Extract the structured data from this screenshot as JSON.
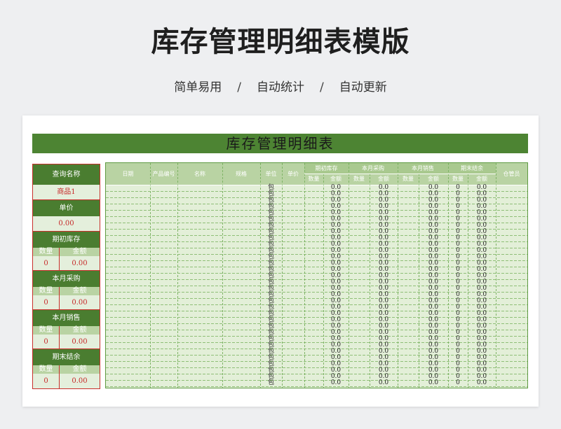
{
  "hero": {
    "title": "库存管理明细表模版",
    "tags": [
      "简单易用",
      "自动统计",
      "自动更新"
    ],
    "separator": "/"
  },
  "sheet": {
    "title": "库存管理明细表",
    "colors": {
      "title_bar": "#4d8433",
      "header_dark": "#4a7d30",
      "header_light": "#b9d3a3",
      "body": "#e3efd8",
      "lookup_border": "#c9302c",
      "value_text": "#c62828"
    }
  },
  "lookup": {
    "query_label": "查询名称",
    "query_value": "商品1",
    "price_label": "单价",
    "price_value": "0.00",
    "qty_label": "数量",
    "amount_label": "金额",
    "sections": [
      {
        "label": "期初库存",
        "qty": "0",
        "amount": "0.00"
      },
      {
        "label": "本月采购",
        "qty": "0",
        "amount": "0.00"
      },
      {
        "label": "本月销售",
        "qty": "0",
        "amount": "0.00"
      },
      {
        "label": "期末结余",
        "qty": "0",
        "amount": "0.00"
      }
    ]
  },
  "table": {
    "headers": [
      "日期",
      "产品编号",
      "名称",
      "规格",
      "单位",
      "单价",
      "期初库存",
      "本月采购",
      "本月销售",
      "期末结余",
      "仓管员"
    ],
    "sub_headers": [
      "数量",
      "金额"
    ],
    "unit_value": "包",
    "qty_value": "0",
    "amount_value": "0.0",
    "row_count": 33
  }
}
